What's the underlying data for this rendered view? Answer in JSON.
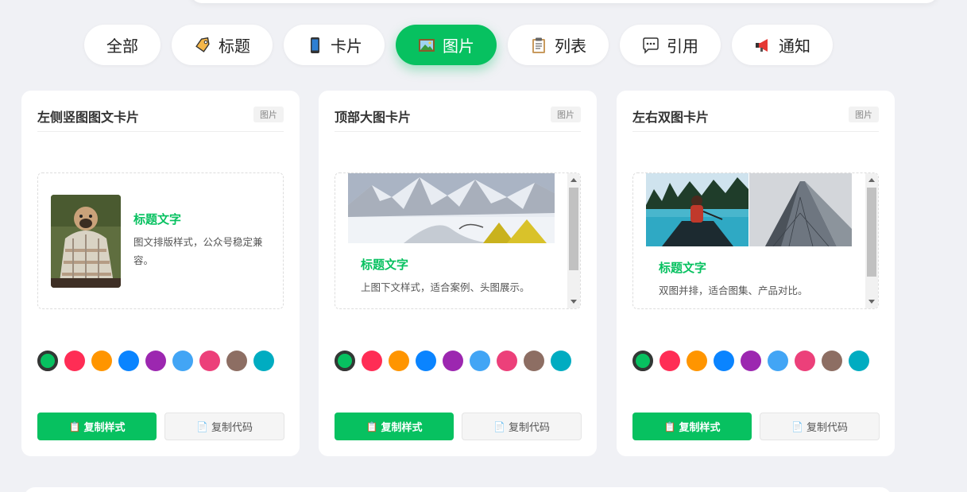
{
  "tabs": [
    {
      "label": "全部",
      "icon": "",
      "active": false
    },
    {
      "label": "标题",
      "icon": "tag-icon",
      "active": false
    },
    {
      "label": "卡片",
      "icon": "phone-icon",
      "active": false
    },
    {
      "label": "图片",
      "icon": "picture-icon",
      "active": true
    },
    {
      "label": "列表",
      "icon": "clipboard-icon",
      "active": false
    },
    {
      "label": "引用",
      "icon": "speech-bubble-icon",
      "active": false
    },
    {
      "label": "通知",
      "icon": "megaphone-icon",
      "active": false
    }
  ],
  "accent": "#07c160",
  "swatch_colors": [
    "#07c160",
    "#ff2d55",
    "#ff9500",
    "#0a84ff",
    "#9c27b0",
    "#42a5f5",
    "#ec407a",
    "#8d6e63",
    "#00acc1"
  ],
  "cards": [
    {
      "title": "左侧竖图图文卡片",
      "tag": "图片",
      "preview_title": "标题文字",
      "preview_text": "图文排版样式，公众号稳定兼容。",
      "copy_style": "复制样式",
      "copy_code": "复制代码"
    },
    {
      "title": "顶部大图卡片",
      "tag": "图片",
      "preview_title": "标题文字",
      "preview_text": "上图下文样式，适合案例、头图展示。",
      "copy_style": "复制样式",
      "copy_code": "复制代码"
    },
    {
      "title": "左右双图卡片",
      "tag": "图片",
      "preview_title": "标题文字",
      "preview_text": "双图并排，适合图集、产品对比。",
      "copy_style": "复制样式",
      "copy_code": "复制代码"
    }
  ]
}
